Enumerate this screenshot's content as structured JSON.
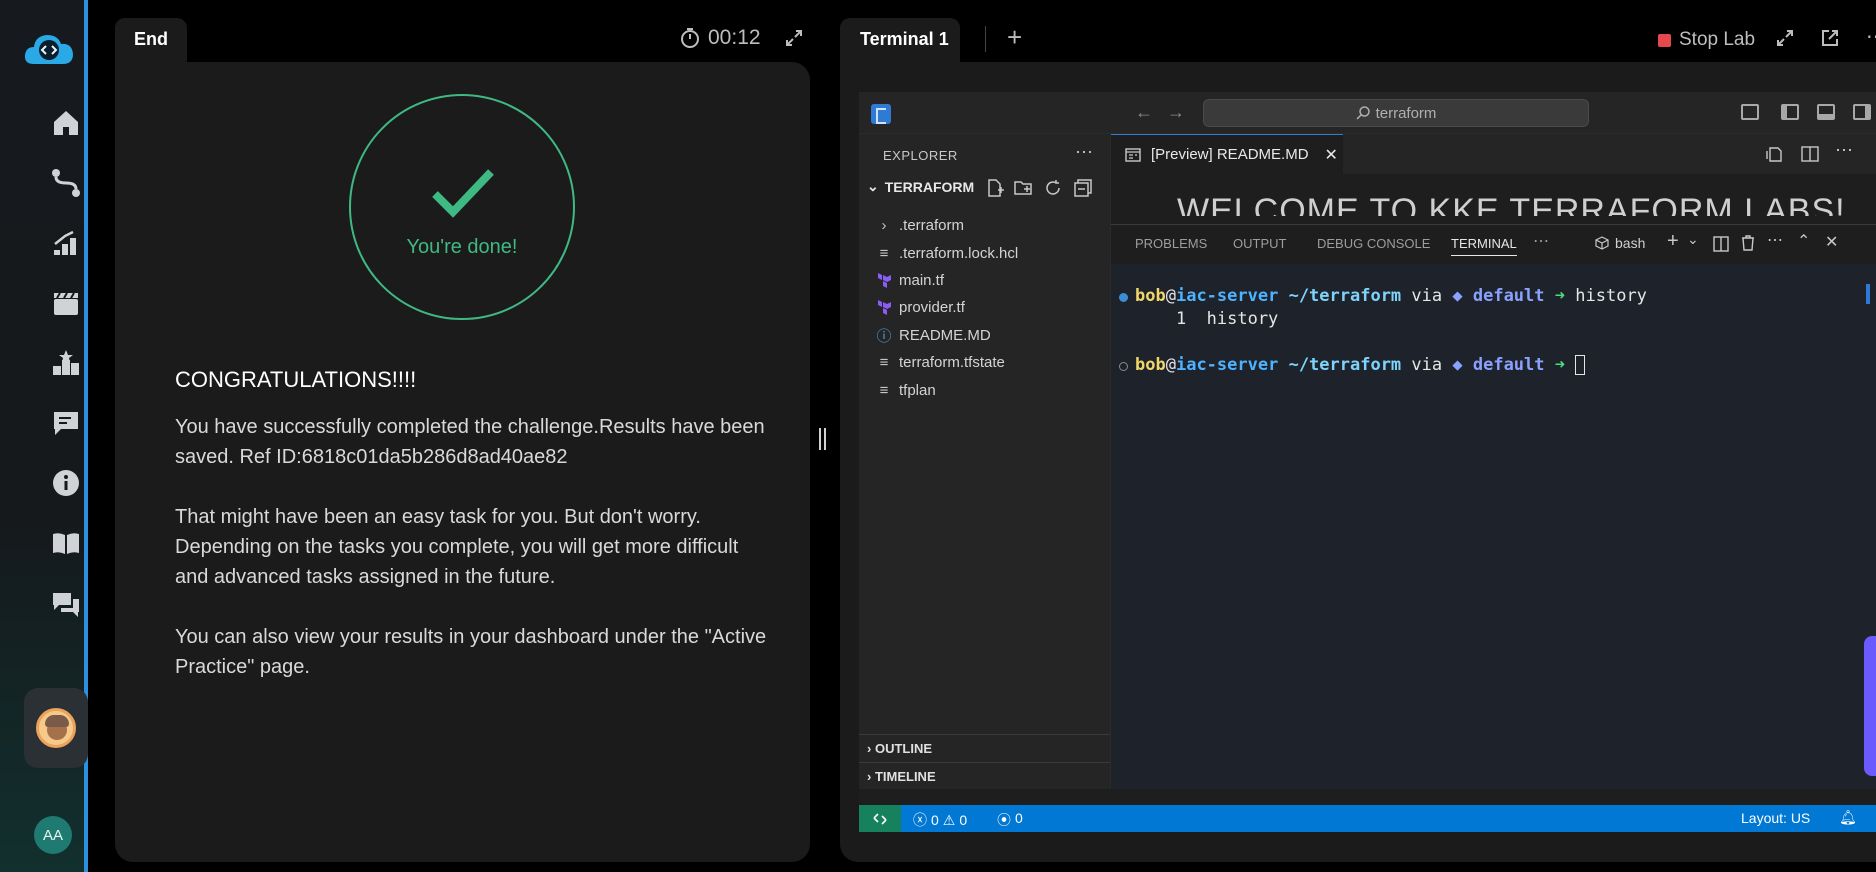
{
  "end_panel": {
    "tab_label": "End",
    "timer": "00:12",
    "done_text": "You're done!",
    "heading": "CONGRATULATIONS!!!!",
    "paragraph1": "You have successfully completed the challenge.Results have been saved. Ref ID:6818c01da5b286d8ad40ae82",
    "paragraph2": "That might have been an easy task for you. But don't worry. Depending on the tasks you complete, you will get more difficult and advanced tasks assigned in the future.",
    "paragraph3": "You can also view your results in your dashboard under the \"Active Practice\" page."
  },
  "terminal_panel": {
    "tab_label": "Terminal 1",
    "stop_label": "Stop Lab"
  },
  "user": {
    "initials": "AA"
  },
  "vscode": {
    "search": "terraform",
    "explorer_title": "EXPLORER",
    "root_folder": "TERRAFORM",
    "files": [
      ".terraform",
      ".terraform.lock.hcl",
      "main.tf",
      "provider.tf",
      "README.MD",
      "terraform.tfstate",
      "tfplan"
    ],
    "outline": "OUTLINE",
    "timeline": "TIMELINE",
    "editor_tab": "[Preview] README.MD",
    "preview_heading": "WELCOME TO KKE TERRAFORM LABS!",
    "panel_tabs": [
      "PROBLEMS",
      "OUTPUT",
      "DEBUG CONSOLE",
      "TERMINAL"
    ],
    "shell": "bash",
    "terminal": {
      "user": "bob",
      "host": "iac-server",
      "path": "~/terraform",
      "via": "via",
      "workspace": "◆ default",
      "arrow": "➜",
      "command": "history",
      "history_line": "    1  history"
    },
    "status": {
      "errors": "0",
      "warnings": "0",
      "ports": "0",
      "layout": "Layout: US"
    }
  }
}
